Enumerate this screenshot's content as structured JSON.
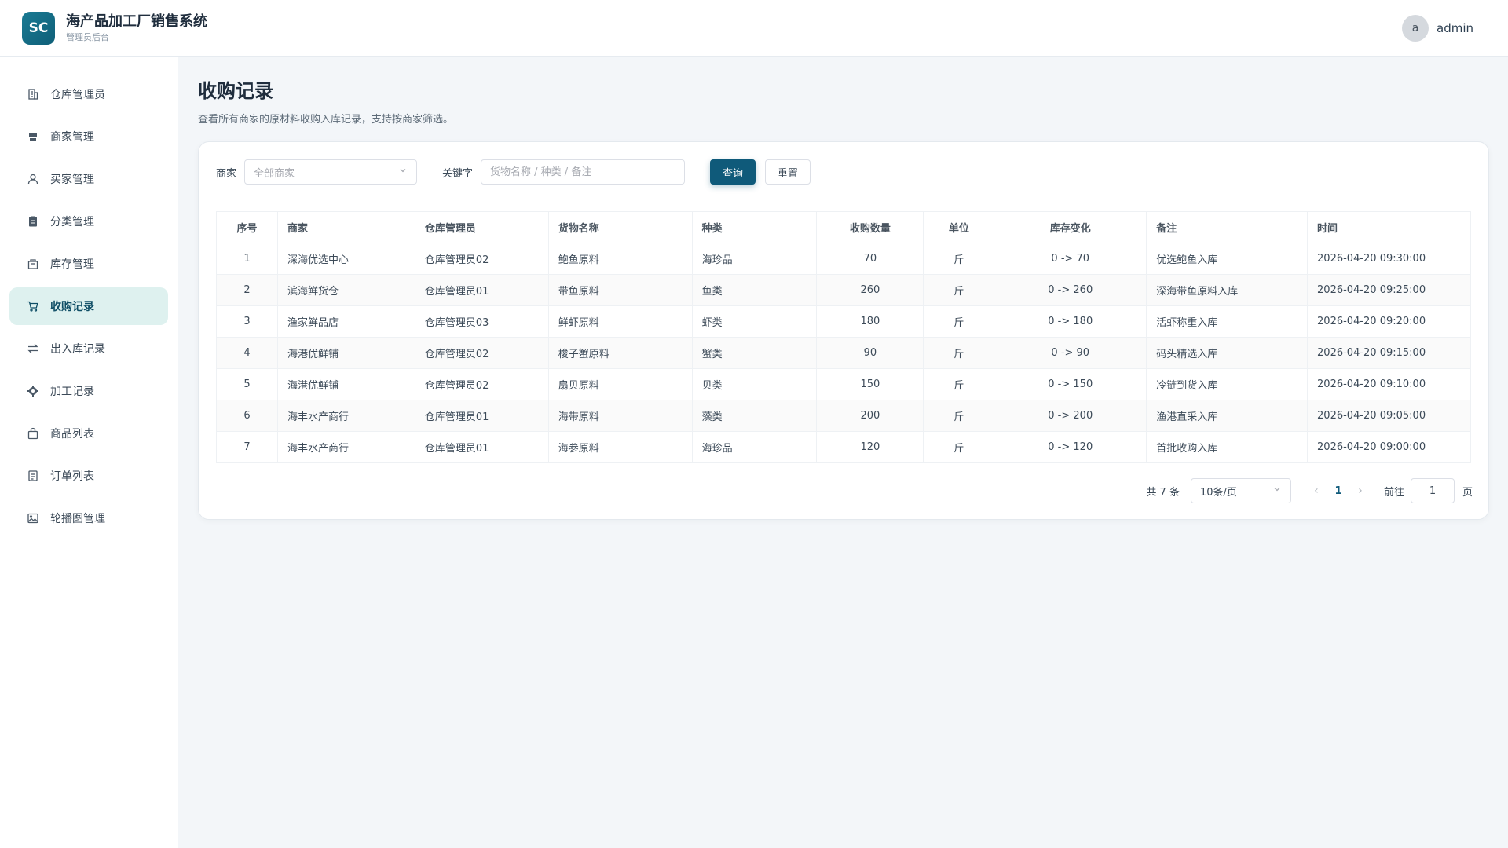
{
  "header": {
    "logo_text": "SC",
    "title": "海产品加工厂销售系统",
    "subtitle": "管理员后台",
    "avatar_letter": "a",
    "username": "admin"
  },
  "sidebar": {
    "items": [
      {
        "label": "仓库管理员",
        "icon": "building-icon"
      },
      {
        "label": "商家管理",
        "icon": "store-icon"
      },
      {
        "label": "买家管理",
        "icon": "user-icon"
      },
      {
        "label": "分类管理",
        "icon": "clipboard-icon"
      },
      {
        "label": "库存管理",
        "icon": "box-icon"
      },
      {
        "label": "收购记录",
        "icon": "cart-icon",
        "active": true
      },
      {
        "label": "出入库记录",
        "icon": "transfer-icon"
      },
      {
        "label": "加工记录",
        "icon": "gear-icon"
      },
      {
        "label": "商品列表",
        "icon": "bag-icon"
      },
      {
        "label": "订单列表",
        "icon": "document-icon"
      },
      {
        "label": "轮播图管理",
        "icon": "image-icon"
      }
    ]
  },
  "page": {
    "title": "收购记录",
    "description": "查看所有商家的原材料收购入库记录，支持按商家筛选。"
  },
  "filters": {
    "merchant_label": "商家",
    "merchant_placeholder": "全部商家",
    "keyword_label": "关键字",
    "keyword_placeholder": "货物名称 / 种类 / 备注",
    "query_button": "查询",
    "reset_button": "重置"
  },
  "table": {
    "columns": [
      "序号",
      "商家",
      "仓库管理员",
      "货物名称",
      "种类",
      "收购数量",
      "单位",
      "库存变化",
      "备注",
      "时间"
    ],
    "rows": [
      [
        "1",
        "深海优选中心",
        "仓库管理员02",
        "鲍鱼原料",
        "海珍品",
        "70",
        "斤",
        "0 -> 70",
        "优选鲍鱼入库",
        "2026-04-20 09:30:00"
      ],
      [
        "2",
        "滨海鲜货仓",
        "仓库管理员01",
        "带鱼原料",
        "鱼类",
        "260",
        "斤",
        "0 -> 260",
        "深海带鱼原料入库",
        "2026-04-20 09:25:00"
      ],
      [
        "3",
        "渔家鲜品店",
        "仓库管理员03",
        "鲜虾原料",
        "虾类",
        "180",
        "斤",
        "0 -> 180",
        "活虾称重入库",
        "2026-04-20 09:20:00"
      ],
      [
        "4",
        "海港优鲜铺",
        "仓库管理员02",
        "梭子蟹原料",
        "蟹类",
        "90",
        "斤",
        "0 -> 90",
        "码头精选入库",
        "2026-04-20 09:15:00"
      ],
      [
        "5",
        "海港优鲜铺",
        "仓库管理员02",
        "扇贝原料",
        "贝类",
        "150",
        "斤",
        "0 -> 150",
        "冷链到货入库",
        "2026-04-20 09:10:00"
      ],
      [
        "6",
        "海丰水产商行",
        "仓库管理员01",
        "海带原料",
        "藻类",
        "200",
        "斤",
        "0 -> 200",
        "渔港直采入库",
        "2026-04-20 09:05:00"
      ],
      [
        "7",
        "海丰水产商行",
        "仓库管理员01",
        "海参原料",
        "海珍品",
        "120",
        "斤",
        "0 -> 120",
        "首批收购入库",
        "2026-04-20 09:00:00"
      ]
    ]
  },
  "pagination": {
    "total": "共 7 条",
    "page_size": "10条/页",
    "current_page": "1",
    "goto_label": "前往",
    "goto_value": "1",
    "page_suffix": "页"
  }
}
